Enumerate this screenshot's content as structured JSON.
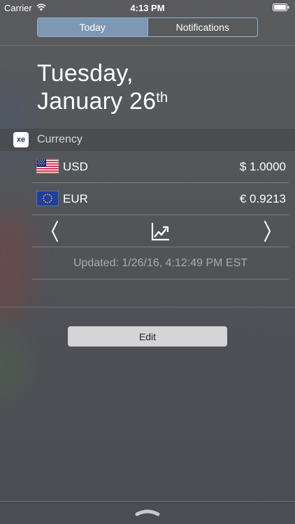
{
  "status_bar": {
    "carrier": "Carrier",
    "time": "4:13 PM"
  },
  "tabs": [
    {
      "label": "Today",
      "active": true
    },
    {
      "label": "Notifications",
      "active": false
    }
  ],
  "date": {
    "weekday": "Tuesday,",
    "month_day": "January 26",
    "ordinal_suffix": "th"
  },
  "widget": {
    "logo_text": "xe",
    "title": "Currency",
    "rates": [
      {
        "code": "USD",
        "value": "$ 1.0000",
        "flag": "us-flag-icon"
      },
      {
        "code": "EUR",
        "value": "€ 0.9213",
        "flag": "eu-flag-icon"
      }
    ],
    "updated": "Updated: 1/26/16, 4:12:49 PM EST"
  },
  "edit_label": "Edit",
  "colors": {
    "active_tab": "#7e97b3",
    "tab_border": "#8fb0d8",
    "edit_button": "#d4d4d6"
  },
  "icons": [
    "wifi-icon",
    "battery-icon",
    "xe-logo",
    "chevron-left-icon",
    "chart-icon",
    "chevron-right-icon",
    "grabber-icon"
  ]
}
